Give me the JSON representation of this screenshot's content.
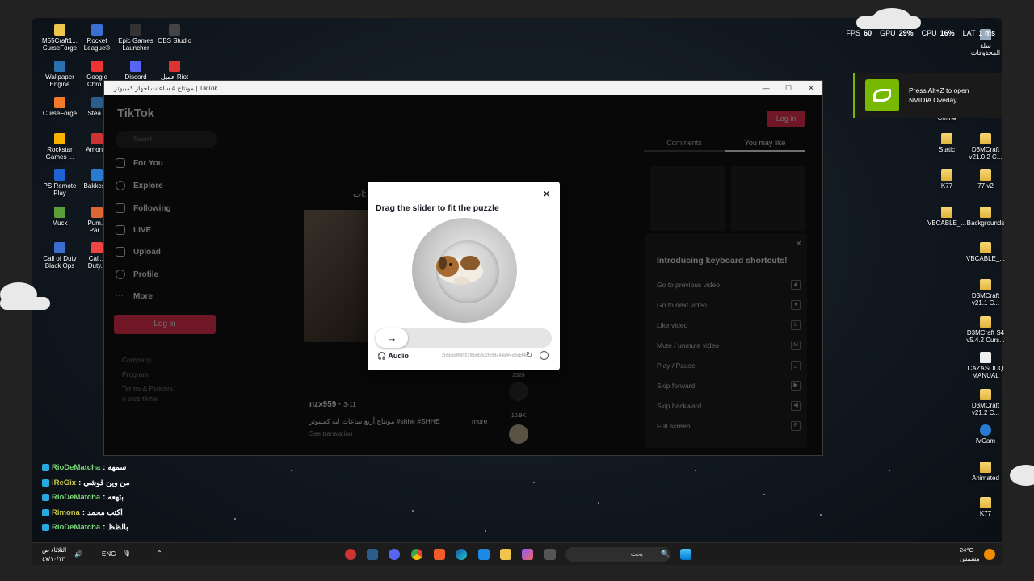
{
  "desktop_icons_left": [
    {
      "label": "M55Craft1...\nCurseForge"
    },
    {
      "label": "Rocket\nLeague®"
    },
    {
      "label": "Epic Games\nLauncher"
    },
    {
      "label": "OBS Studio"
    },
    {
      "label": "Wallpaper\nEngine"
    },
    {
      "label": "Google\nChro..."
    },
    {
      "label": "Discord"
    },
    {
      "label": "عميل Riot"
    },
    {
      "label": "CurseForge"
    },
    {
      "label": "Stea..."
    },
    {
      "label": "Rockstar\nGames ..."
    },
    {
      "label": "Amon..."
    },
    {
      "label": "PS Remote\nPlay"
    },
    {
      "label": "Bakkes..."
    },
    {
      "label": "Muck"
    },
    {
      "label": "Pum...\nPar..."
    },
    {
      "label": "Call of Duty\nBlack Ops"
    },
    {
      "label": "Call...\nDuty..."
    }
  ],
  "desktop_icons_right": [
    {
      "label": "سلة\nالمحذوفات"
    },
    {
      "label": "Offline"
    },
    {
      "label": "Static"
    },
    {
      "label": "D3MCraft\nv21.0.2 C..."
    },
    {
      "label": "K77"
    },
    {
      "label": "77 v2"
    },
    {
      "label": "VBCABLE_..."
    },
    {
      "label": "Backgrounds"
    },
    {
      "label": "VBCABLE_..."
    },
    {
      "label": "D3MCraft\nv21.1 C..."
    },
    {
      "label": "D3MCraft S4\nv5.4.2 Curs..."
    },
    {
      "label": "CAZASOUQ\nMANUAL"
    },
    {
      "label": "D3MCraft\nv21.2 C..."
    },
    {
      "label": "iVCam"
    },
    {
      "label": "Animated"
    },
    {
      "label": "K77"
    }
  ],
  "hud": {
    "fps_label": "FPS",
    "fps_value": "60",
    "gpu_label": "GPU",
    "gpu_value": "29%",
    "cpu_label": "CPU",
    "cpu_value": "16%",
    "lat_label": "LAT",
    "lat_value": "1 ms"
  },
  "nvidia": {
    "line1": "Press Alt+Z to open",
    "line2": "NVIDIA Overlay",
    "accent": "#76b900"
  },
  "window": {
    "title": "مونتاج 4 ساعات اجهاز كمبيوتر | TikTok"
  },
  "tiktok": {
    "logo": "TikTok",
    "search_placeholder": "Search",
    "nav": [
      "For You",
      "Explore",
      "Following",
      "LIVE",
      "Upload",
      "Profile",
      "More"
    ],
    "login_side": "Log in",
    "footer": [
      "Company",
      "Program",
      "Terms & Policies",
      "© 2026 TikTok"
    ],
    "login_top": "Log in",
    "tabs": [
      "Comments",
      "You may like"
    ],
    "author": "nzx959",
    "date": "3-11",
    "caption": "مونتاج أربع ساعات ليه كمبيوتر #shhe #SHHE",
    "more": "more",
    "see_translation": "See translation",
    "overlay_text": "ات:",
    "share_count": "2328",
    "fav_count": "10.9K",
    "accent": "#fe2c55"
  },
  "shortcuts": {
    "title": "Introducing keyboard shortcuts!",
    "items": [
      {
        "label": "Go to previous video",
        "key": "▲"
      },
      {
        "label": "Go to next video",
        "key": "▼"
      },
      {
        "label": "Like video",
        "key": "L"
      },
      {
        "label": "Mute / unmute video",
        "key": "M"
      },
      {
        "label": "Play / Pause",
        "key": "␣"
      },
      {
        "label": "Skip forward",
        "key": "▶"
      },
      {
        "label": "Skip backward",
        "key": "◀"
      },
      {
        "label": "Full screen",
        "key": "F"
      }
    ]
  },
  "captcha": {
    "title": "Drag the slider to fit the puzzle",
    "audio": "Audio",
    "code": "2b5b9dff6f053f8b0b8d2fcf8fa44b4f4d8dbf4b"
  },
  "chat": [
    {
      "user": "RioDeMatcha",
      "msg": "سمهه",
      "user_color": "#7dd87a"
    },
    {
      "user": "iReGix",
      "msg": "من وين قوشي",
      "user_color": "#c9c94a"
    },
    {
      "user": "RioDeMatcha",
      "msg": "بتهعه",
      "user_color": "#7dd87a"
    },
    {
      "user": "Rimona",
      "msg": "اكتب محمد",
      "user_color": "#c9c94a"
    },
    {
      "user": "RioDeMatcha",
      "msg": "بالظظ",
      "user_color": "#7dd87a"
    }
  ],
  "taskbar": {
    "time": "الثلاثاء ص",
    "date": "٤٧/١٠/١٣",
    "lang": "ENG",
    "search": "بحث",
    "weather_temp": "24°C",
    "weather_desc": "مشمس"
  }
}
